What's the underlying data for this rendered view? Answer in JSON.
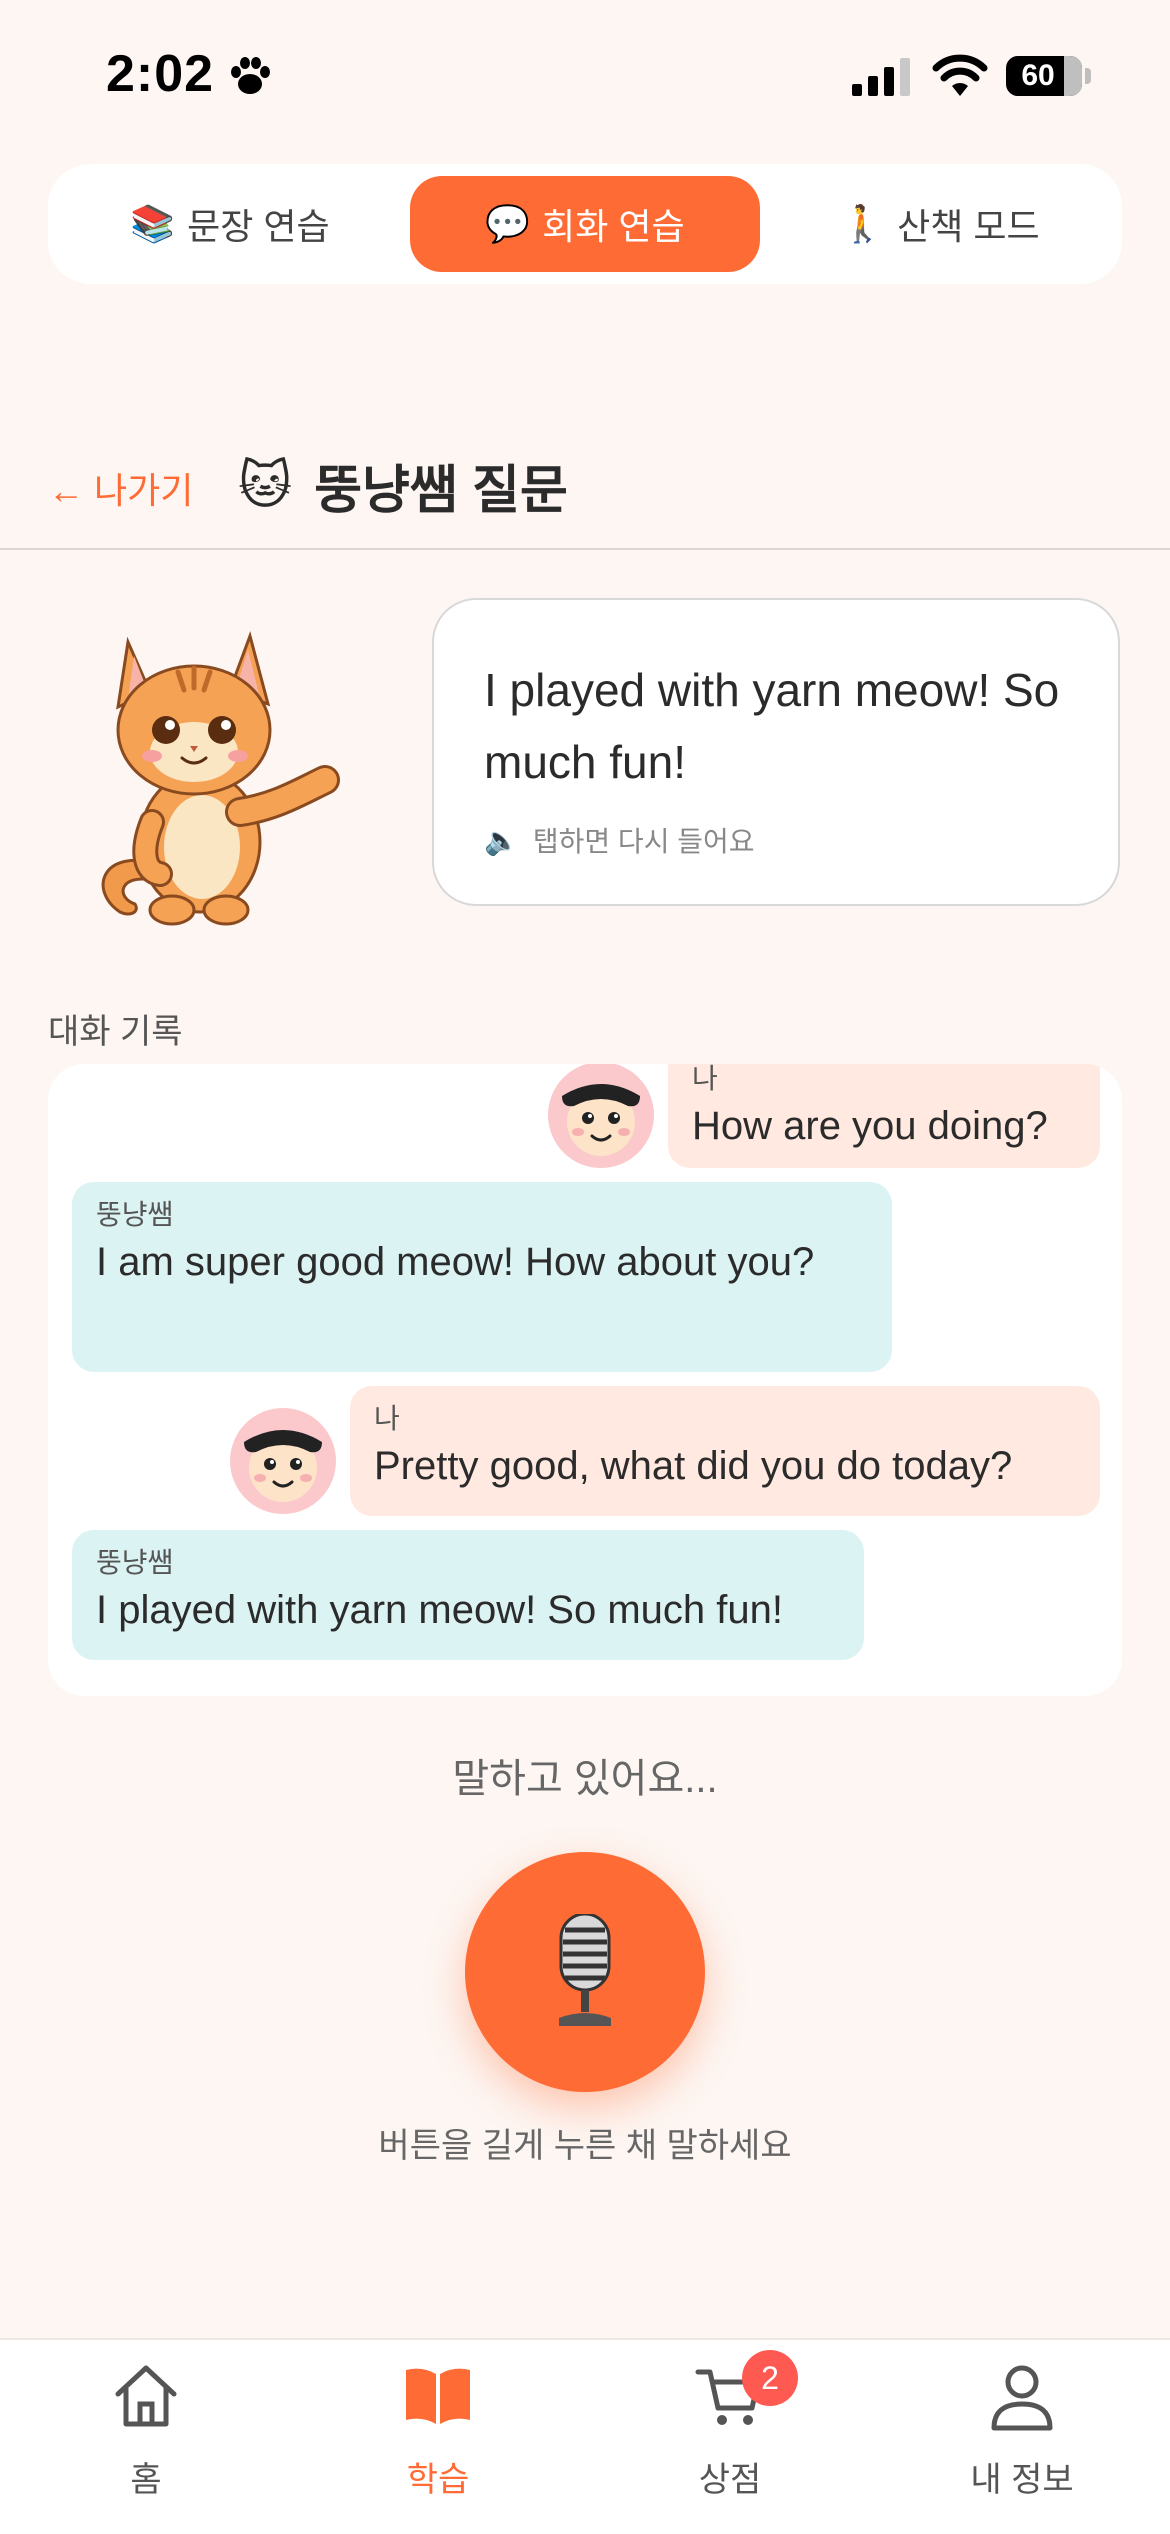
{
  "status_bar": {
    "time": "2:02",
    "battery": "60"
  },
  "mode_tabs": [
    {
      "emoji": "📚",
      "label": "문장 연습",
      "active": false
    },
    {
      "emoji": "💬",
      "label": "회화 연습",
      "active": true
    },
    {
      "emoji": "🚶",
      "label": "산책 모드",
      "active": false
    }
  ],
  "header": {
    "back_label": "← 나가기",
    "title_emoji": "🐱",
    "title": "뚱냥쌤 질문"
  },
  "speech_card": {
    "text": "I played with yarn meow! So much fun!",
    "replay_icon": "🔈",
    "replay_hint": "탭하면 다시 들어요"
  },
  "history": {
    "label": "대화 기록",
    "messages": [
      {
        "speaker": "나",
        "text": "How are you doing?"
      },
      {
        "speaker": "뚱냥쌤",
        "text": "I am super good meow! How about you?"
      },
      {
        "speaker": "나",
        "text": "Pretty good, what did you do today?"
      },
      {
        "speaker": "뚱냥쌤",
        "text": "I played with yarn meow! So much fun!"
      }
    ]
  },
  "speaking_status": "말하고 있어요...",
  "mic": {
    "hint": "버튼을 길게 누른 채 말하세요"
  },
  "bottom_nav": [
    {
      "label": "홈",
      "icon": "home-icon",
      "active": false
    },
    {
      "label": "학습",
      "icon": "book-icon",
      "active": true
    },
    {
      "label": "상점",
      "icon": "cart-icon",
      "active": false,
      "badge": "2"
    },
    {
      "label": "내 정보",
      "icon": "user-icon",
      "active": false
    }
  ],
  "colors": {
    "accent": "#ff6b35",
    "background": "#fdf6f2",
    "me_bubble": "#ffe9e0",
    "cat_bubble": "#dcf3f3",
    "badge": "#ff5a52"
  }
}
